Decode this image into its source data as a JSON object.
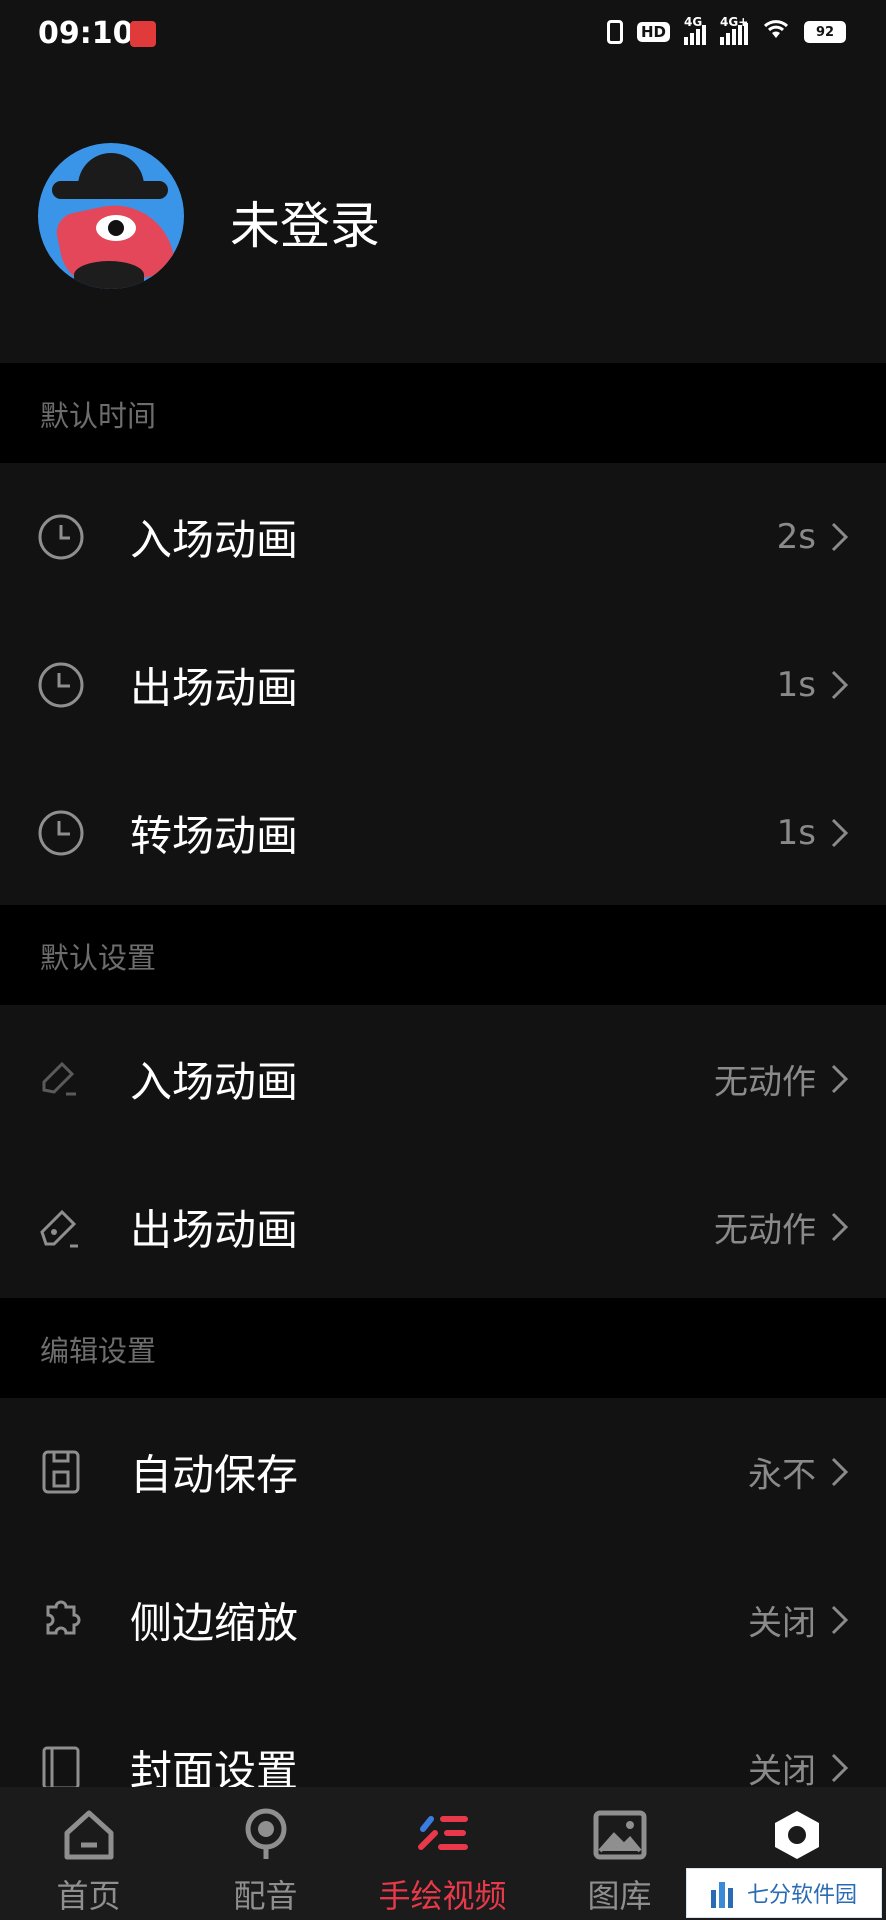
{
  "status_bar": {
    "time": "09:10",
    "hd": "HD",
    "signal1": "4G",
    "signal2": "4G+",
    "battery": "92"
  },
  "profile": {
    "username": "未登录"
  },
  "sections": [
    {
      "title": "默认时间",
      "rows": [
        {
          "label": "入场动画",
          "value": "2s",
          "icon": "clock-icon"
        },
        {
          "label": "出场动画",
          "value": "1s",
          "icon": "clock-icon"
        },
        {
          "label": "转场动画",
          "value": "1s",
          "icon": "clock-icon"
        }
      ]
    },
    {
      "title": "默认设置",
      "rows": [
        {
          "label": "入场动画",
          "value": "无动作",
          "icon": "pencil-icon"
        },
        {
          "label": "出场动画",
          "value": "无动作",
          "icon": "eraser-icon"
        }
      ]
    },
    {
      "title": "编辑设置",
      "rows": [
        {
          "label": "自动保存",
          "value": "永不",
          "icon": "save-icon"
        },
        {
          "label": "侧边缩放",
          "value": "关闭",
          "icon": "puzzle-icon"
        },
        {
          "label": "封面设置",
          "value": "关闭",
          "icon": "cover-icon"
        }
      ]
    }
  ],
  "tabbar": {
    "tabs": [
      {
        "label": "首页",
        "icon": "home-icon",
        "active": false
      },
      {
        "label": "配音",
        "icon": "microphone-icon",
        "active": false
      },
      {
        "label": "手绘视频",
        "icon": "draw-video-icon",
        "active": true
      },
      {
        "label": "图库",
        "icon": "gallery-icon",
        "active": false
      },
      {
        "label": "",
        "icon": "settings-hexagon-icon",
        "active": false
      }
    ]
  },
  "watermark": {
    "text": "七分软件园"
  },
  "colors": {
    "accent": "#e8394a",
    "background": "#000000",
    "panel": "#121212",
    "secondary_text": "#8a8a8a"
  }
}
